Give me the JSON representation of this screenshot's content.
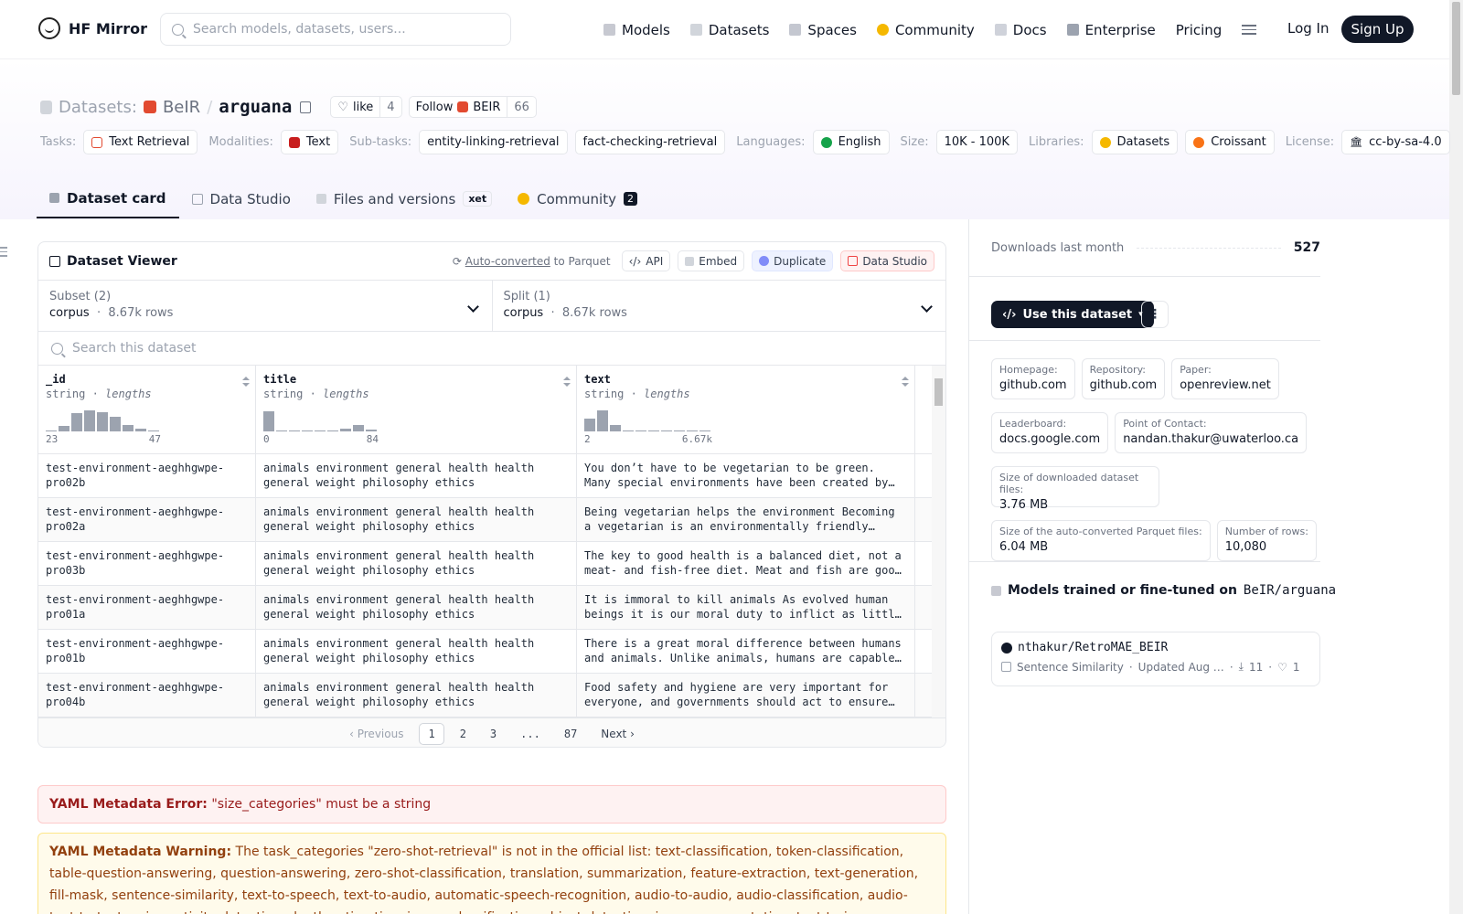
{
  "header": {
    "brand": "HF Mirror",
    "search_placeholder": "Search models, datasets, users...",
    "nav": [
      "Models",
      "Datasets",
      "Spaces",
      "Community",
      "Docs",
      "Enterprise",
      "Pricing"
    ],
    "login": "Log In",
    "signup": "Sign Up"
  },
  "dataset": {
    "section": "Datasets:",
    "org": "BeIR",
    "sep": "/",
    "name": "arguana",
    "like_label": "like",
    "like_count": "4",
    "follow_label": "Follow",
    "follow_org": "BEIR",
    "follow_count": "66"
  },
  "tags": {
    "tasks_label": "Tasks:",
    "tasks": "Text Retrieval",
    "modalities_label": "Modalities:",
    "modalities": "Text",
    "subtasks_label": "Sub-tasks:",
    "subtask1": "entity-linking-retrieval",
    "subtask2": "fact-checking-retrieval",
    "languages_label": "Languages:",
    "language": "English",
    "size_label": "Size:",
    "size": "10K - 100K",
    "libraries_label": "Libraries:",
    "lib1": "Datasets",
    "lib2": "Croissant",
    "license_label": "License:",
    "license": "cc-by-sa-4.0"
  },
  "tabs": {
    "card": "Dataset card",
    "studio": "Data Studio",
    "files": "Files and versions",
    "xet": "xet",
    "community": "Community",
    "community_count": "2"
  },
  "viewer": {
    "title": "Dataset Viewer",
    "autoconv": "Auto-converted",
    "autoconv_to": "to Parquet",
    "api": "API",
    "embed": "Embed",
    "duplicate": "Duplicate",
    "studio": "Data Studio",
    "subset_label": "Subset (2)",
    "subset_value": "corpus",
    "subset_rows": "8.67k rows",
    "split_label": "Split (1)",
    "split_value": "corpus",
    "split_rows": "8.67k rows",
    "search_placeholder": "Search this dataset",
    "columns": [
      {
        "name": "_id",
        "type": "string",
        "stat": "lengths",
        "min": "23",
        "max": "47",
        "hist": [
          0.05,
          0.22,
          0.75,
          0.9,
          0.8,
          0.6,
          0.25,
          0.12,
          0.05
        ]
      },
      {
        "name": "title",
        "type": "string",
        "stat": "lengths",
        "min": "0",
        "max": "84",
        "hist": [
          0.85,
          0.03,
          0.05,
          0.05,
          0.05,
          0.05,
          0.1,
          0.25,
          0.07
        ]
      },
      {
        "name": "text",
        "type": "string",
        "stat": "lengths",
        "min": "2",
        "max": "6.67k",
        "hist": [
          0.55,
          0.9,
          0.25,
          0.05,
          0.03,
          0.03,
          0.03,
          0.03,
          0.03,
          0.03
        ]
      }
    ],
    "rows": [
      {
        "id": "test-environment-aeghhgwpe-pro02b",
        "title": "animals environment general health health general weight philosophy ethics",
        "text": "You don’t have to be vegetarian to be green. Many special environments have been created by livestock farming."
      },
      {
        "id": "test-environment-aeghhgwpe-pro02a",
        "title": "animals environment general health health general weight philosophy ethics",
        "text": "Being vegetarian helps the environment Becoming a vegetarian is an environmentally friendly thing to do."
      },
      {
        "id": "test-environment-aeghhgwpe-pro03b",
        "title": "animals environment general health health general weight philosophy ethics",
        "text": "The key to good health is a balanced diet, not a meat- and fish-free diet. Meat and fish are good sources."
      },
      {
        "id": "test-environment-aeghhgwpe-pro01a",
        "title": "animals environment general health health general weight philosophy ethics",
        "text": "It is immoral to kill animals As evolved human beings it is our moral duty to inflict as little pain."
      },
      {
        "id": "test-environment-aeghhgwpe-pro01b",
        "title": "animals environment general health health general weight philosophy ethics",
        "text": "There is a great moral difference between humans and animals. Unlike animals, humans are capable of moral reasoning."
      },
      {
        "id": "test-environment-aeghhgwpe-pro04b",
        "title": "animals environment general health health general weight philosophy ethics",
        "text": "Food safety and hygiene are very important for everyone, and governments should act to ensure that."
      }
    ],
    "pager": {
      "prev": "Previous",
      "pages": [
        "1",
        "2",
        "3",
        "...",
        "87"
      ],
      "next": "Next"
    }
  },
  "alerts": {
    "error_label": "YAML Metadata Error:",
    "error_text": "\"size_categories\" must be a string",
    "warn_label": "YAML Metadata Warning:",
    "warn_text": "The task_categories \"zero-shot-retrieval\" is not in the official list: text-classification, token-classification, table-question-answering, question-answering, zero-shot-classification, translation, summarization, feature-extraction, text-generation, fill-mask, sentence-similarity, text-to-speech, text-to-audio, automatic-speech-recognition, audio-to-audio, audio-classification, audio-text-to-text, voice-activity-detection, depth-estimation, image-classification, object-detection, image-segmentation, text-to-image, image-to-text"
  },
  "sidebar": {
    "downloads_label": "Downloads last month",
    "downloads": "527",
    "use_button": "Use this dataset",
    "homepage_label": "Homepage:",
    "homepage": "github.com",
    "repo_label": "Repository:",
    "repo": "github.com",
    "paper_label": "Paper:",
    "paper": "openreview.net",
    "leaderboard_label": "Leaderboard:",
    "leaderboard": "docs.google.com",
    "contact_label": "Point of Contact:",
    "contact": "nandan.thakur@uwaterloo.ca",
    "dl_size_label": "Size of downloaded dataset files:",
    "dl_size": "3.76 MB",
    "parquet_label": "Size of the auto-converted Parquet files:",
    "parquet": "6.04 MB",
    "rows_label": "Number of rows:",
    "rows": "10,080",
    "models_heading": "Models trained or fine-tuned on",
    "models_dataset": "BeIR/arguana",
    "model_name": "nthakur/RetroMAE_BEIR",
    "model_task": "Sentence Similarity",
    "model_updated": "Updated Aug …",
    "model_downloads": "11",
    "model_likes": "1"
  },
  "colors": {
    "dark": "#111827",
    "accent": "#e24a30",
    "tabbg": "#f6f4fd"
  }
}
